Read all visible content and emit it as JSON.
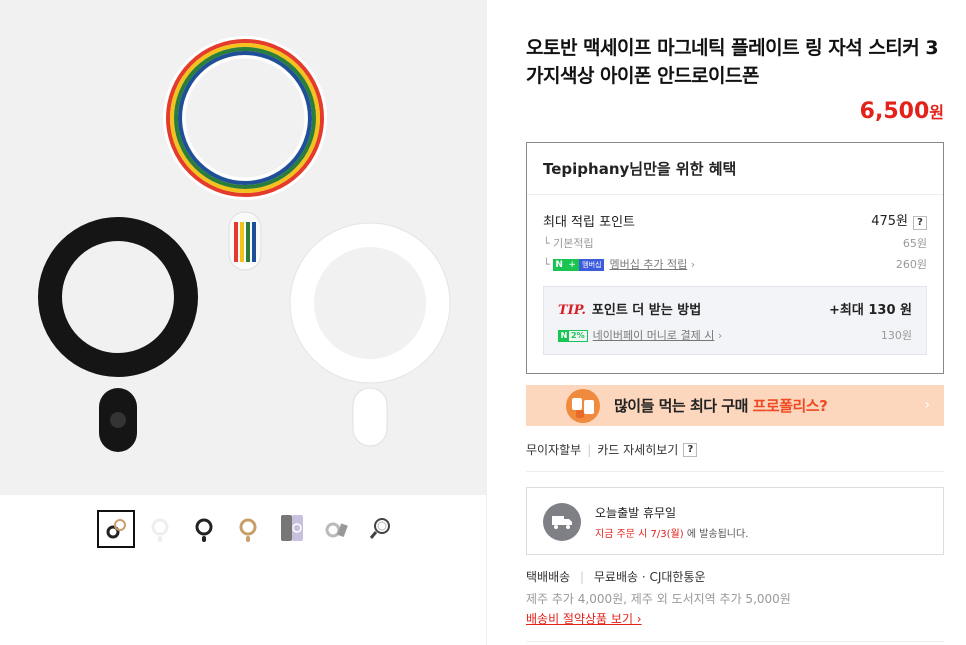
{
  "product": {
    "title": "오토반 맥세이프 마그네틱 플레이트 링 자석 스티커 3가지색상 아이폰 안드로이드폰",
    "price": "6,500",
    "price_unit": "원"
  },
  "gallery": {
    "thumbnails": [
      "gold-ring-set",
      "white-ring",
      "black-ring",
      "gold-ring",
      "phone-case",
      "ring-angle",
      "ring-closeup"
    ]
  },
  "benefits": {
    "title": "Tepiphany님만을 위한 혜택",
    "max_points_label": "최대 적립 포인트",
    "max_points_value": "475원",
    "help": "?",
    "basic_label": "기본적립",
    "basic_value": "65원",
    "n_badge": "N",
    "plus_badge": "+",
    "membership_badge": "멤버십",
    "membership_label": "멤버십 추가 적립",
    "membership_value": "260원",
    "tip_label": "TIP.",
    "tip_text": "포인트 더 받는 방법",
    "tip_value": "+최대 130",
    "tip_value_unit": "원",
    "pct_badge": "2%",
    "npay_label": "네이버페이 머니로 결제 시",
    "npay_value": "130원"
  },
  "banner": {
    "text_prefix": "많이들 먹는 최다 구매 ",
    "text_highlight": "프로폴리스?",
    "arrow": "›"
  },
  "installment": {
    "label": "무이자할부",
    "card_label": "카드 자세히보기",
    "help": "?"
  },
  "shipping": {
    "title": "오늘출발 휴무일",
    "notice_red": "지금 주문 시 7/3(월)",
    "notice_rest": " 에 발송됩니다.",
    "method": "택배배송",
    "free": "무료배송 · CJ대한통운",
    "extra": "제주 추가 4,000원, 제주 외 도서지역 추가 5,000원",
    "save_link": "배송비 절약상품 보기 ›"
  },
  "colors": {
    "price_red": "#e3221b",
    "npay_green": "#19c452",
    "banner_bg": "#fcd7bd"
  }
}
